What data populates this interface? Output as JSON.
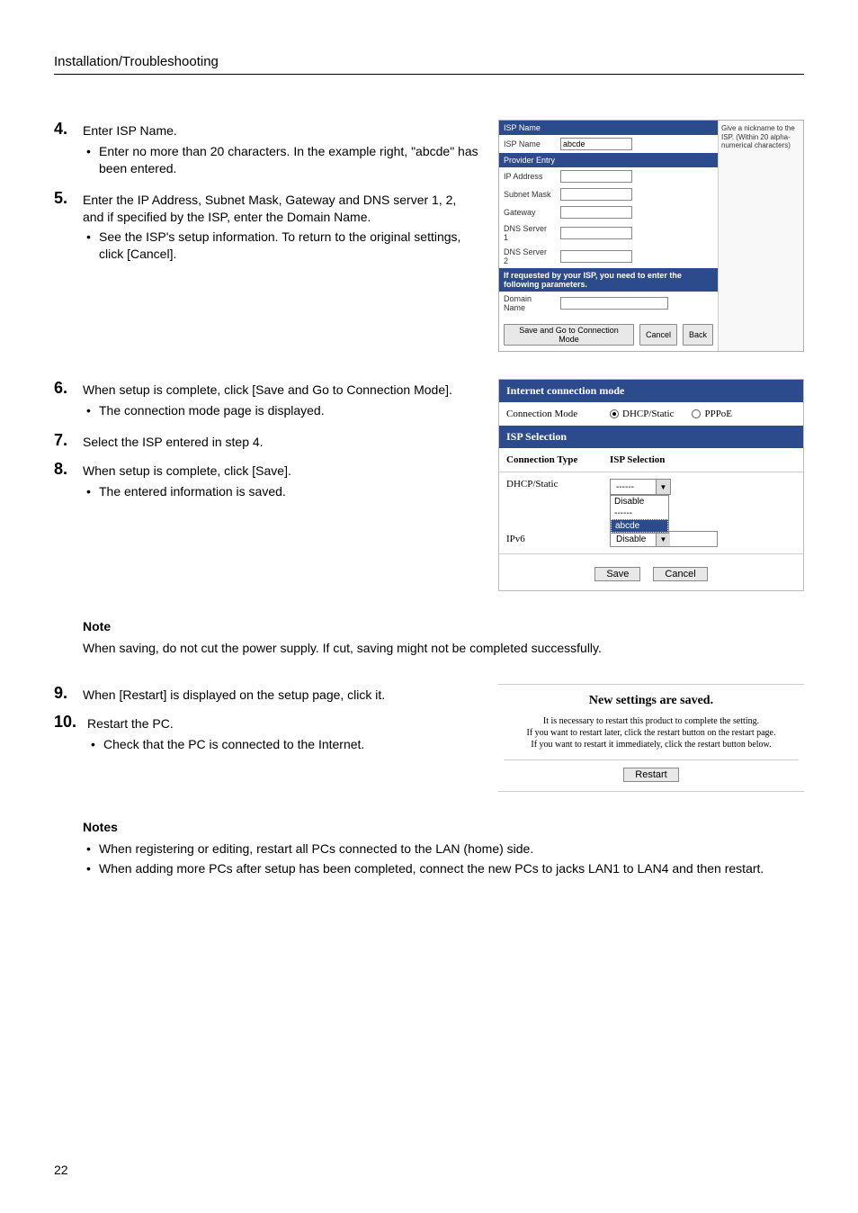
{
  "header": {
    "title": "Installation/Troubleshooting"
  },
  "page_number": "22",
  "steps": {
    "s4": {
      "num": "4.",
      "text": "Enter ISP Name.",
      "bullets": [
        "Enter no more than 20 characters. In the example right, \"abcde\" has been entered."
      ]
    },
    "s5": {
      "num": "5.",
      "text": "Enter the IP Address, Subnet Mask, Gateway and DNS server 1, 2, and if specified by the ISP, enter the Domain Name.",
      "bullets": [
        "See the ISP's setup information. To return to the original settings, click [Cancel]."
      ]
    },
    "s6": {
      "num": "6.",
      "text": "When setup is complete, click [Save and Go to Connection Mode].",
      "bullets": [
        "The connection mode page is displayed."
      ]
    },
    "s7": {
      "num": "7.",
      "text": "Select the ISP entered in step 4."
    },
    "s8": {
      "num": "8.",
      "text": "When setup is complete, click [Save].",
      "bullets": [
        "The entered information is saved."
      ]
    },
    "s9": {
      "num": "9.",
      "text": "When [Restart] is displayed on the setup page, click it."
    },
    "s10": {
      "num": "10.",
      "text": "Restart the PC.",
      "bullets": [
        "Check that the PC is connected to the Internet."
      ]
    }
  },
  "note1": {
    "title": "Note",
    "body": "When saving, do not cut the power supply. If cut, saving might not be completed successfully."
  },
  "notes2": {
    "title": "Notes",
    "bullets": [
      "When registering or editing, restart all PCs connected to the LAN (home) side.",
      "When adding more PCs after setup has been completed, connect the new PCs to jacks LAN1 to LAN4 and then restart."
    ]
  },
  "fig1": {
    "side_note": "Give a nickname to the ISP. (Within 20 alpha-numerical characters)",
    "bar_isp_name": "ISP Name",
    "label_isp_name": "ISP Name",
    "input_isp_name": "abcde",
    "bar_provider": "Provider Entry",
    "label_ip": "IP Address",
    "label_subnet": "Subnet Mask",
    "label_gateway": "Gateway",
    "label_dns1": "DNS Server 1",
    "label_dns2": "DNS Server 2",
    "bar_if_requested": "If requested by your ISP, you need to enter the following parameters.",
    "label_domain": "Domain Name",
    "btn_save_go": "Save and Go to Connection Mode",
    "btn_cancel": "Cancel",
    "btn_back": "Back"
  },
  "fig2": {
    "bar_mode": "Internet connection mode",
    "label_mode": "Connection Mode",
    "radio_dhcp": "DHCP/Static",
    "radio_pppoe": "PPPoE",
    "bar_isp_sel": "ISP Selection",
    "col_type": "Connection Type",
    "col_sel": "ISP Selection",
    "row_dhcp": "DHCP/Static",
    "row_ipv6": "IPv6",
    "sel_visible": "------",
    "sel_ipv6": "Disable",
    "opt_disable": "Disable",
    "opt_dash": "------",
    "opt_abcde": "abcde",
    "btn_save": "Save",
    "btn_cancel": "Cancel"
  },
  "fig3": {
    "title": "New settings are saved.",
    "line1": "It is necessary to restart this product to complete the setting.",
    "line2": "If you want to restart later, click the restart button on the restart page.",
    "line3": "If you want to restart it immediately, click the restart button below.",
    "btn_restart": "Restart"
  }
}
